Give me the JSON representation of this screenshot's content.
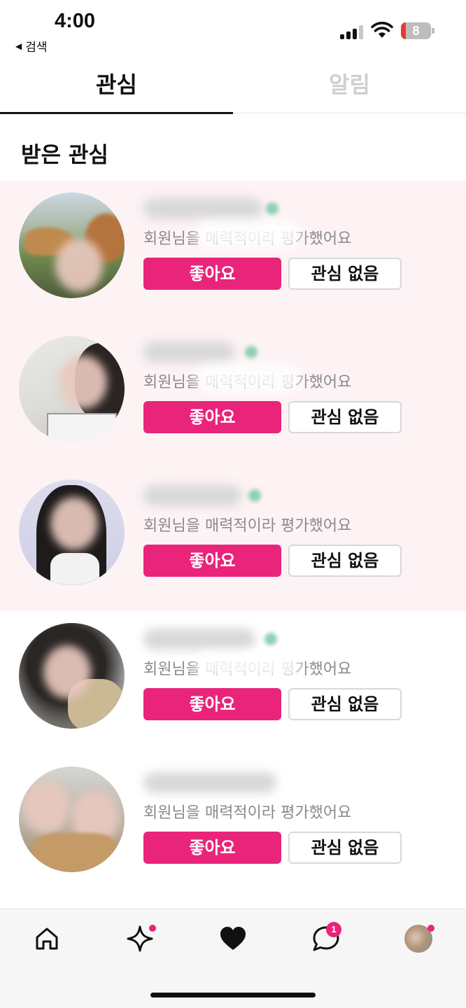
{
  "status_bar": {
    "time": "4:00",
    "back_app": "검색",
    "battery": "8"
  },
  "tabs": [
    {
      "label": "관심",
      "active": true
    },
    {
      "label": "알림",
      "active": false
    }
  ],
  "section_title": "받은 관심",
  "items": [
    {
      "description": "회원님을 매력적이라 평가했어요",
      "like_label": "좋아요",
      "pass_label": "관심 없음",
      "highlighted": true
    },
    {
      "description": "회원님을 매력적이라 평가했어요",
      "like_label": "좋아요",
      "pass_label": "관심 없음",
      "highlighted": true
    },
    {
      "description": "회원님을 매력적이라 평가했어요",
      "like_label": "좋아요",
      "pass_label": "관심 없음",
      "highlighted": true
    },
    {
      "description": "회원님을 매력적이라 평가했어요",
      "like_label": "좋아요",
      "pass_label": "관심 없음",
      "highlighted": false
    },
    {
      "description": "회원님을 매력적이라 평가했어요",
      "like_label": "좋아요",
      "pass_label": "관심 없음",
      "highlighted": false
    }
  ],
  "bottom_nav": {
    "items": [
      "home-icon",
      "sparkle-icon",
      "heart-icon",
      "chat-icon",
      "profile-avatar"
    ],
    "chat_badge": "1"
  },
  "colors": {
    "accent": "#e9247a",
    "highlight_bg": "#fdf3f5"
  }
}
